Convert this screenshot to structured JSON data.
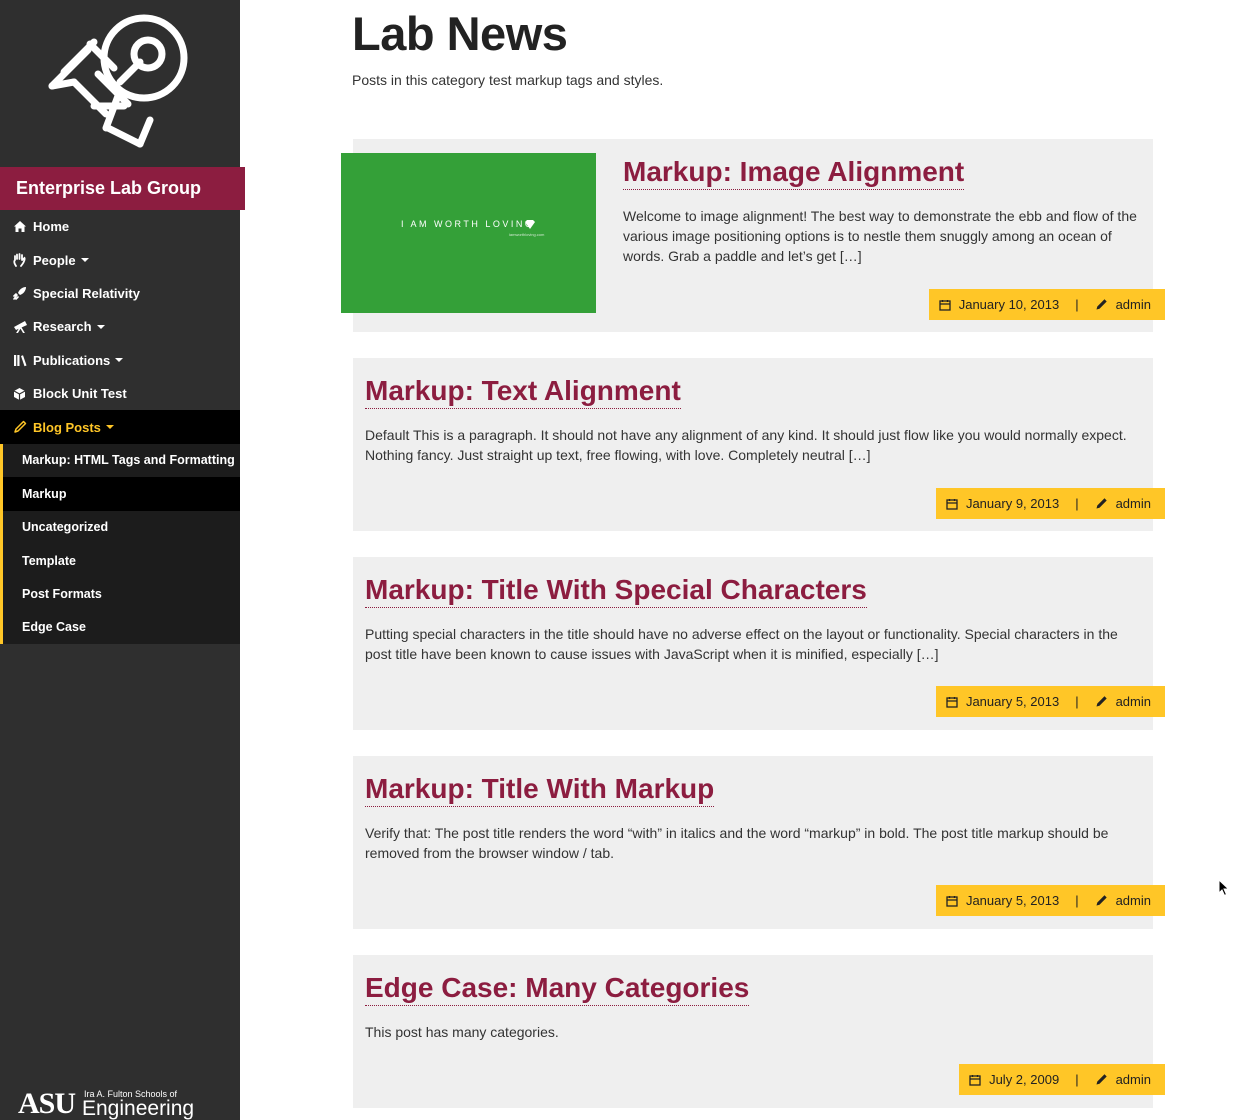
{
  "sidebar": {
    "site_title": "Enterprise Lab Group",
    "nav": [
      {
        "label": "Home",
        "icon": "home-icon",
        "dropdown": false
      },
      {
        "label": "People",
        "icon": "hand-icon",
        "dropdown": true
      },
      {
        "label": "Special Relativity",
        "icon": "rocket-icon",
        "dropdown": false
      },
      {
        "label": "Research",
        "icon": "telescope-icon",
        "dropdown": true
      },
      {
        "label": "Publications",
        "icon": "books-icon",
        "dropdown": true
      },
      {
        "label": "Block Unit Test",
        "icon": "cube-icon",
        "dropdown": false
      },
      {
        "label": "Blog Posts",
        "icon": "pencil-icon",
        "dropdown": true
      }
    ],
    "blog_subnav": [
      "Markup: HTML Tags and Formatting",
      "Markup",
      "Uncategorized",
      "Template",
      "Post Formats",
      "Edge Case"
    ],
    "footer_logo": {
      "mark": "ASU",
      "line1": "Ira A. Fulton Schools of",
      "line2": "Engineering"
    }
  },
  "main": {
    "title": "Lab News",
    "description": "Posts in this category test markup tags and styles.",
    "posts": [
      {
        "title": "Markup: Image Alignment",
        "excerpt": "Welcome to image alignment! The best way to demonstrate the ebb and flow of the various image positioning options is to nestle them snuggly among an ocean of words. Grab a paddle and let’s get […]",
        "date": "January 10, 2013",
        "author": "admin",
        "thumbnail": {
          "text": "I AM WORTH LOVING",
          "subtext": "iamworthloving.com"
        }
      },
      {
        "title": "Markup: Text Alignment",
        "excerpt": "Default This is a paragraph. It should not have any alignment of any kind. It should just flow like you would normally expect. Nothing fancy. Just straight up text, free flowing, with love. Completely neutral […]",
        "date": "January 9, 2013",
        "author": "admin"
      },
      {
        "title": "Markup: Title With Special Characters",
        "excerpt": "Putting special characters in the title should have no adverse effect on the layout or functionality. Special characters in the post title have been known to cause issues with JavaScript when it is minified, especially […]",
        "date": "January 5, 2013",
        "author": "admin"
      },
      {
        "title": "Markup: Title With Markup",
        "excerpt": "Verify that: The post title renders the word “with” in italics and the word “markup” in bold. The post title markup should be removed from the browser window / tab.",
        "date": "January 5, 2013",
        "author": "admin"
      },
      {
        "title": "Edge Case: Many Categories",
        "excerpt": "This post has many categories.",
        "date": "July 2, 2009",
        "author": "admin"
      }
    ],
    "meta_separator": "|"
  },
  "colors": {
    "sidebar_bg": "#2f2f2f",
    "maroon": "#8c1d40",
    "gold": "#ffc627",
    "card_bg": "#efefef",
    "thumbnail_green": "#34a038"
  }
}
